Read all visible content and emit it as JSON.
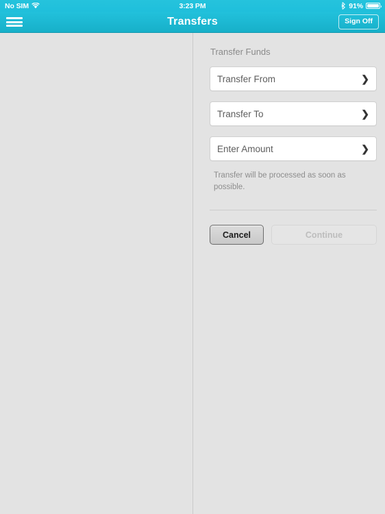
{
  "status_bar": {
    "carrier": "No SIM",
    "wifi_icon": "wifi-icon",
    "time": "3:23 PM",
    "bluetooth_icon": "bluetooth-icon",
    "battery_percent": "91%",
    "battery_icon": "battery-icon"
  },
  "nav_bar": {
    "menu_icon": "hamburger-menu-icon",
    "title": "Transfers",
    "sign_off_label": "Sign Off"
  },
  "main": {
    "section_title": "Transfer Funds",
    "fields": [
      {
        "label": "Transfer From",
        "chevron": "❯"
      },
      {
        "label": "Transfer To",
        "chevron": "❯"
      },
      {
        "label": "Enter Amount",
        "chevron": "❯"
      }
    ],
    "helper_text": "Transfer will be processed as soon as possible.",
    "buttons": {
      "cancel_label": "Cancel",
      "continue_label": "Continue"
    }
  },
  "colors": {
    "accent": "#1fbfdb",
    "nav_bottom": "#17b0c9",
    "background": "#e3e3e3",
    "field_background": "#ffffff",
    "divider": "#cccccc"
  }
}
